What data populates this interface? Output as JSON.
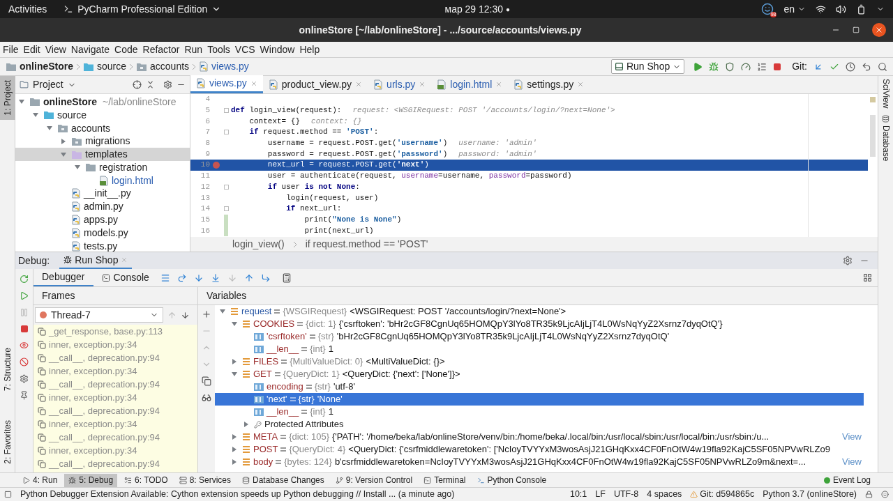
{
  "system_bar": {
    "activities": "Activities",
    "app_menu": "PyCharm Professional Edition",
    "clock": "мар 29  12:30",
    "indicator": "●",
    "notification_badge": "98",
    "language": "en"
  },
  "window": {
    "title": "onlineStore [~/lab/onlineStore] - .../source/accounts/views.py"
  },
  "menu": [
    "File",
    "Edit",
    "View",
    "Navigate",
    "Code",
    "Refactor",
    "Run",
    "Tools",
    "VCS",
    "Window",
    "Help"
  ],
  "navigation": {
    "breadcrumbs": [
      {
        "label": "onlineStore",
        "kind": "project"
      },
      {
        "label": "source",
        "kind": "source"
      },
      {
        "label": "accounts",
        "kind": "package"
      },
      {
        "label": "views.py",
        "kind": "py"
      }
    ],
    "run_config": "Run Shop",
    "git_label": "Git:"
  },
  "left_stripe": {
    "top": [
      {
        "label": "1: Project",
        "selected": true
      }
    ],
    "bottom": [
      {
        "label": "7: Structure",
        "selected": false
      },
      {
        "label": "2: Favorites",
        "selected": false
      }
    ]
  },
  "project_panel": {
    "title": "Project",
    "tree": [
      {
        "label": "onlineStore",
        "detail": "~/lab/onlineStore",
        "kind": "project",
        "expanded": true,
        "selected": false,
        "children": [
          {
            "label": "source",
            "kind": "source",
            "expanded": true,
            "selected": false,
            "children": [
              {
                "label": "accounts",
                "kind": "package",
                "expanded": true,
                "selected": false,
                "children": [
                  {
                    "label": "migrations",
                    "kind": "package",
                    "expanded": false,
                    "selected": false
                  },
                  {
                    "label": "templates",
                    "kind": "templates",
                    "expanded": true,
                    "selected": true,
                    "children": [
                      {
                        "label": "registration",
                        "kind": "folder",
                        "expanded": true,
                        "selected": false,
                        "children": [
                          {
                            "label": "login.html",
                            "kind": "html",
                            "modified": true,
                            "selected": false
                          }
                        ]
                      }
                    ]
                  },
                  {
                    "label": "__init__.py",
                    "kind": "py",
                    "modified": false,
                    "selected": false
                  },
                  {
                    "label": "admin.py",
                    "kind": "py",
                    "modified": false,
                    "selected": false
                  },
                  {
                    "label": "apps.py",
                    "kind": "py",
                    "modified": false,
                    "selected": false
                  },
                  {
                    "label": "models.py",
                    "kind": "py",
                    "modified": false,
                    "selected": false
                  },
                  {
                    "label": "tests.py",
                    "kind": "py",
                    "modified": false,
                    "selected": false
                  }
                ]
              }
            ]
          }
        ]
      }
    ]
  },
  "editor_tabs": [
    {
      "label": "views.py",
      "kind": "py",
      "modified": true,
      "selected": true
    },
    {
      "label": "product_view.py",
      "kind": "py",
      "modified": false,
      "selected": false
    },
    {
      "label": "urls.py",
      "kind": "py",
      "modified": true,
      "selected": false
    },
    {
      "label": "login.html",
      "kind": "html",
      "modified": true,
      "selected": false
    },
    {
      "label": "settings.py",
      "kind": "py",
      "modified": false,
      "selected": false
    }
  ],
  "code": [
    {
      "number": "4"
    },
    {
      "number": "5",
      "fold": true,
      "tokens": [
        {
          "kind": "kw",
          "text": "def"
        },
        {
          "kind": "plain",
          "text": " login_view(request):"
        }
      ],
      "hint": "request: <WSGIRequest: POST '/accounts/login/?next=None'>"
    },
    {
      "number": "6",
      "tokens": [
        {
          "kind": "plain",
          "text": "    context= {}"
        }
      ],
      "hint": "context: {}"
    },
    {
      "number": "7",
      "fold": true,
      "tokens": [
        {
          "kind": "kw",
          "text": "    if"
        },
        {
          "kind": "plain",
          "text": " request.method == "
        },
        {
          "kind": "str",
          "text": "'POST'"
        },
        {
          "kind": "plain",
          "text": ":"
        }
      ]
    },
    {
      "number": "8",
      "tokens": [
        {
          "kind": "plain",
          "text": "        username = request.POST.get("
        },
        {
          "kind": "str",
          "text": "'username'"
        },
        {
          "kind": "plain",
          "text": ")"
        }
      ],
      "hint": "username: 'admin'"
    },
    {
      "number": "9",
      "tokens": [
        {
          "kind": "plain",
          "text": "        password = request.POST.get("
        },
        {
          "kind": "str",
          "text": "'password'"
        },
        {
          "kind": "plain",
          "text": ")"
        }
      ],
      "hint": "password: 'admin'"
    },
    {
      "number": "10",
      "breakpoint": true,
      "current": true,
      "tokens": [
        {
          "kind": "plain",
          "text": "        next_url = request.POST.get("
        },
        {
          "kind": "str",
          "text": "'next'"
        },
        {
          "kind": "plain",
          "text": ")"
        }
      ]
    },
    {
      "number": "11",
      "tokens": [
        {
          "kind": "plain",
          "text": "        user = authenticate(request, "
        },
        {
          "kind": "param",
          "text": "username"
        },
        {
          "kind": "plain",
          "text": "=username, "
        },
        {
          "kind": "param",
          "text": "password"
        },
        {
          "kind": "plain",
          "text": "=password)"
        }
      ]
    },
    {
      "number": "12",
      "fold": true,
      "tokens": [
        {
          "kind": "kw",
          "text": "        if"
        },
        {
          "kind": "plain",
          "text": " user "
        },
        {
          "kind": "kw",
          "text": "is not None"
        },
        {
          "kind": "plain",
          "text": ":"
        }
      ]
    },
    {
      "number": "13",
      "tokens": [
        {
          "kind": "plain",
          "text": "            login(request, user)"
        }
      ]
    },
    {
      "number": "14",
      "fold": true,
      "tokens": [
        {
          "kind": "kw",
          "text": "            if"
        },
        {
          "kind": "plain",
          "text": " next_url:"
        }
      ]
    },
    {
      "number": "15",
      "changed": true,
      "tokens": [
        {
          "kind": "plain",
          "text": "                print("
        },
        {
          "kind": "str",
          "text": "\"None is None\""
        },
        {
          "kind": "plain",
          "text": ")"
        }
      ]
    },
    {
      "number": "16",
      "changed": true,
      "tokens": [
        {
          "kind": "plain",
          "text": "                print(next_url)"
        }
      ]
    }
  ],
  "editor_breadcrumbs": [
    "login_view()",
    "if request.method == 'POST'"
  ],
  "right_stripe": [
    {
      "label": "SciView",
      "kind": "sciview"
    },
    {
      "label": "Database",
      "kind": "database"
    }
  ],
  "debug": {
    "label": "Debug:",
    "session_tab": "Run Shop",
    "tabs": [
      {
        "label": "Debugger",
        "kind": "debugger",
        "selected": true
      },
      {
        "label": "Console",
        "kind": "console",
        "selected": false
      }
    ],
    "frames_title": "Frames",
    "variables_title": "Variables",
    "thread": "Thread-7",
    "frames": [
      "_get_response, base.py:113",
      "inner, exception.py:34",
      "__call__, deprecation.py:94",
      "inner, exception.py:34",
      "__call__, deprecation.py:94",
      "inner, exception.py:34",
      "__call__, deprecation.py:94",
      "inner, exception.py:34",
      "__call__, deprecation.py:94",
      "inner, exception.py:34",
      "__call__, deprecation.py:94"
    ],
    "variables": [
      {
        "name": "request",
        "kind": "object",
        "type": "{WSGIRequest}",
        "value": "<WSGIRequest: POST '/accounts/login/?next=None'>",
        "expanded": true,
        "selected": false,
        "children": [
          {
            "name": "COOKIES",
            "kind": "field",
            "type": "{dict: 1}",
            "value": "{'csrftoken': 'bHr2cGF8CgnUq65HOMQpY3lYo8TR35k9LjcAIjLjT4L0WsNqYyZ2Xsrnz7dyqOtQ'}",
            "expanded": true,
            "selected": false,
            "children": [
              {
                "name": "'csrftoken'",
                "kind": "value",
                "type": "{str}",
                "value": "'bHr2cGF8CgnUq65HOMQpY3lYo8TR35k9LjcAIjLjT4L0WsNqYyZ2Xsrnz7dyqOtQ'",
                "selected": false
              },
              {
                "name": "__len__",
                "kind": "value",
                "type": "{int}",
                "value": "1",
                "selected": false
              }
            ]
          },
          {
            "name": "FILES",
            "kind": "field",
            "type": "{MultiValueDict: 0}",
            "value": "<MultiValueDict: {}>",
            "expanded": false,
            "selected": false
          },
          {
            "name": "GET",
            "kind": "field",
            "type": "{QueryDict: 1}",
            "value": "<QueryDict: {'next': ['None']}>",
            "expanded": true,
            "selected": false,
            "children": [
              {
                "name": "encoding",
                "kind": "value",
                "type": "{str}",
                "value": "'utf-8'",
                "selected": false
              },
              {
                "name": "'next'",
                "kind": "value",
                "type": "{str}",
                "value": "'None'",
                "selected": true
              },
              {
                "name": "__len__",
                "kind": "value",
                "type": "{int}",
                "value": "1",
                "selected": false
              },
              {
                "name": "Protected Attributes",
                "kind": "protected",
                "expanded": false,
                "selected": false
              }
            ]
          },
          {
            "name": "META",
            "kind": "field",
            "type": "{dict: 105}",
            "value": "{'PATH': '/home/beka/lab/onlineStore/venv/bin:/home/beka/.local/bin:/usr/local/sbin:/usr/local/bin:/usr/sbin:/u...",
            "link": "View",
            "expanded": false,
            "selected": false
          },
          {
            "name": "POST",
            "kind": "field",
            "type": "{QueryDict: 4}",
            "value": "<QueryDict: {'csrfmiddlewaretoken': ['NcIoyTVYYxM3wosAsjJ21GHqKxx4CF0FnOtW4w19fla92KajC5SF05NPVwRLZo9",
            "expanded": false,
            "selected": false
          },
          {
            "name": "body",
            "kind": "field",
            "type": "{bytes: 124}",
            "value": "b'csrfmiddlewaretoken=NcIoyTVYYxM3wosAsjJ21GHqKxx4CF0FnOtW4w19fla92KajC5SF05NPVwRLZo9m&next=...",
            "link": "View",
            "expanded": false,
            "selected": false
          }
        ]
      }
    ]
  },
  "bottom_tabs": [
    {
      "label": "4: Run",
      "kind": "run",
      "selected": false
    },
    {
      "label": "5: Debug",
      "kind": "debug",
      "selected": true
    },
    {
      "label": "6: TODO",
      "kind": "todo",
      "selected": false
    },
    {
      "label": "8: Services",
      "kind": "services",
      "selected": false
    },
    {
      "label": "Database Changes",
      "kind": "database",
      "selected": false
    },
    {
      "label": "9: Version Control",
      "kind": "vcs",
      "selected": false
    },
    {
      "label": "Terminal",
      "kind": "terminal",
      "selected": false
    },
    {
      "label": "Python Console",
      "kind": "console",
      "selected": false
    }
  ],
  "event_log": "Event Log",
  "status_bar": {
    "message": "Python Debugger Extension Available: Cython extension speeds up Python debugging // Install  ... (a minute ago)",
    "items": [
      "10:1",
      "LF",
      "UTF-8",
      "4 spaces"
    ],
    "git": "Git: d594865c",
    "interpreter": "Python 3.7 (onlineStore)"
  }
}
